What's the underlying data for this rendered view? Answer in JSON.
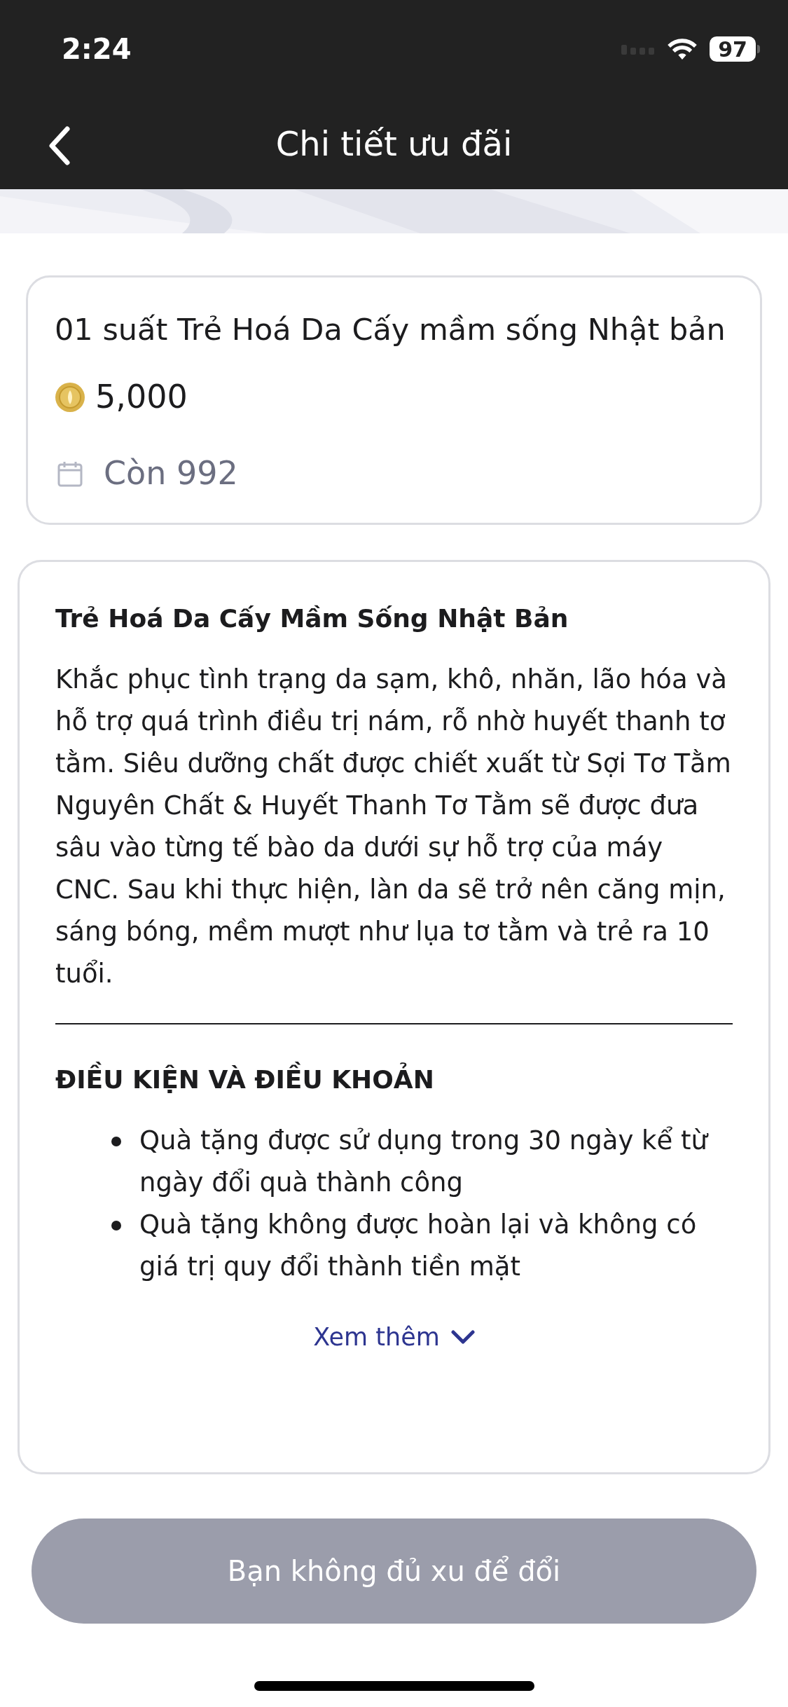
{
  "status_bar": {
    "time": "2:24",
    "battery": "97"
  },
  "header": {
    "title": "Chi tiết ưu đãi"
  },
  "offer": {
    "title": "01 suất Trẻ Hoá Da Cấy mầm sống Nhật bản",
    "price": "5,000",
    "remaining": "Còn 992"
  },
  "details": {
    "heading": "Trẻ Hoá Da Cấy Mầm Sống Nhật Bản",
    "description": "Khắc phục tình trạng da sạm, khô, nhăn, lão hóa và hỗ trợ quá trình điều trị nám, rỗ nhờ huyết thanh tơ tằm. Siêu dưỡng chất được chiết xuất từ Sợi Tơ Tằm Nguyên Chất & Huyết Thanh Tơ Tằm sẽ được đưa sâu vào từng tế bào da dưới sự hỗ trợ của máy CNC. Sau khi thực hiện, làn da sẽ trở nên căng mịn, sáng bóng, mềm mượt như lụa tơ tằm và trẻ ra 10 tuổi.",
    "terms_heading": "ĐIỀU KIỆN VÀ ĐIỀU KHOẢN",
    "terms": [
      "Quà tặng được sử dụng trong 30 ngày kể từ ngày đổi quà thành công",
      "Quà tặng không được hoàn lại và không có giá trị quy đổi thành tiền mặt"
    ],
    "more_link": "Xem thêm"
  },
  "action_button": {
    "label": "Bạn không đủ xu để đổi",
    "disabled": true
  }
}
